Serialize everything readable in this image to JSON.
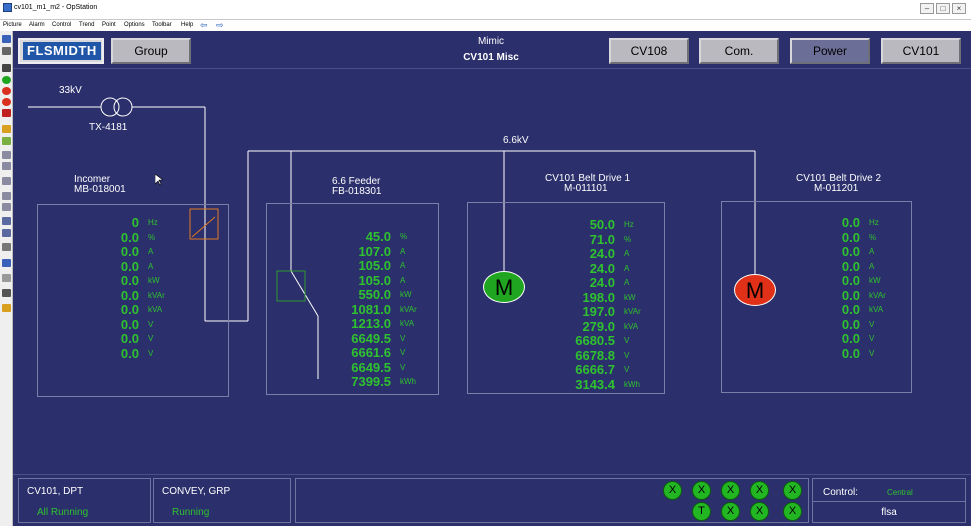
{
  "window": {
    "title": "cv101_m1_m2 - OpStation"
  },
  "menu": [
    "Picture",
    "Alarm",
    "Control",
    "Trend",
    "Point",
    "Options",
    "Toolbar",
    "Help"
  ],
  "header": {
    "logo_text": "FLSMIDTH",
    "group_label": "Group",
    "title_line1": "Mimic",
    "title_line2": "CV101 Misc",
    "nav_buttons": [
      "CV108",
      "Com.",
      "Power",
      "CV101"
    ]
  },
  "diagram": {
    "supply_label": "33kV",
    "transformer_label": "TX-4181",
    "bus_label": "6.6kV"
  },
  "panels": [
    {
      "title1": "Incomer",
      "title2": "MB-018001",
      "values": [
        "0",
        "0.0",
        "0.0",
        "0.0",
        "0.0",
        "0.0",
        "0.0",
        "0.0",
        "0.0",
        "0.0"
      ],
      "units": [
        "Hz",
        "%",
        "A",
        "A",
        "A",
        "kW",
        "kVAr",
        "kVA",
        "V",
        "V",
        "V"
      ]
    },
    {
      "title1": "6.6 Feeder",
      "title2": "FB-018301",
      "values": [
        "45.0",
        "107.0",
        "105.0",
        "105.0",
        "550.0",
        "1081.0",
        "1213.0",
        "6649.5",
        "6661.6",
        "6649.5",
        "7399.5"
      ],
      "units": [
        "%",
        "A",
        "A",
        "A",
        "kW",
        "kVAr",
        "kVA",
        "V",
        "V",
        "V",
        "kWh"
      ]
    },
    {
      "title1": "CV101 Belt Drive 1",
      "title2": "M-011101",
      "motor_label": "M",
      "motor_color": "#1fa51f",
      "values": [
        "50.0",
        "71.0",
        "24.0",
        "24.0",
        "24.0",
        "198.0",
        "197.0",
        "279.0",
        "6680.5",
        "6678.8",
        "6666.7",
        "3143.4"
      ],
      "units": [
        "Hz",
        "%",
        "A",
        "A",
        "A",
        "kW",
        "kVAr",
        "kVA",
        "V",
        "V",
        "V",
        "kWh"
      ]
    },
    {
      "title1": "CV101 Belt Drive 2",
      "title2": "M-011201",
      "motor_label": "M",
      "motor_color": "#e03018",
      "values": [
        "0.0",
        "0.0",
        "0.0",
        "0.0",
        "0.0",
        "0.0",
        "0.0",
        "0.0",
        "0.0",
        "0.0"
      ],
      "units": [
        "Hz",
        "%",
        "A",
        "A",
        "A",
        "kW",
        "kVAr",
        "kVA",
        "V",
        "V",
        "V"
      ]
    }
  ],
  "footer": {
    "box1_title": "CV101, DPT",
    "box1_status": "All Running",
    "box2_title": "CONVEY, GRP",
    "box2_status": "Running",
    "indicators_top": [
      "X",
      "X",
      "X",
      "X",
      "X"
    ],
    "indicators_bottom": [
      "T",
      "X",
      "X",
      "X"
    ],
    "control_label": "Control:",
    "control_value": "Central",
    "user": "flsa"
  },
  "colors": {
    "value_green": "#2fc22f",
    "background": "#2b2f6b",
    "running_motor": "#1fa51f",
    "stopped_motor": "#e03018"
  }
}
